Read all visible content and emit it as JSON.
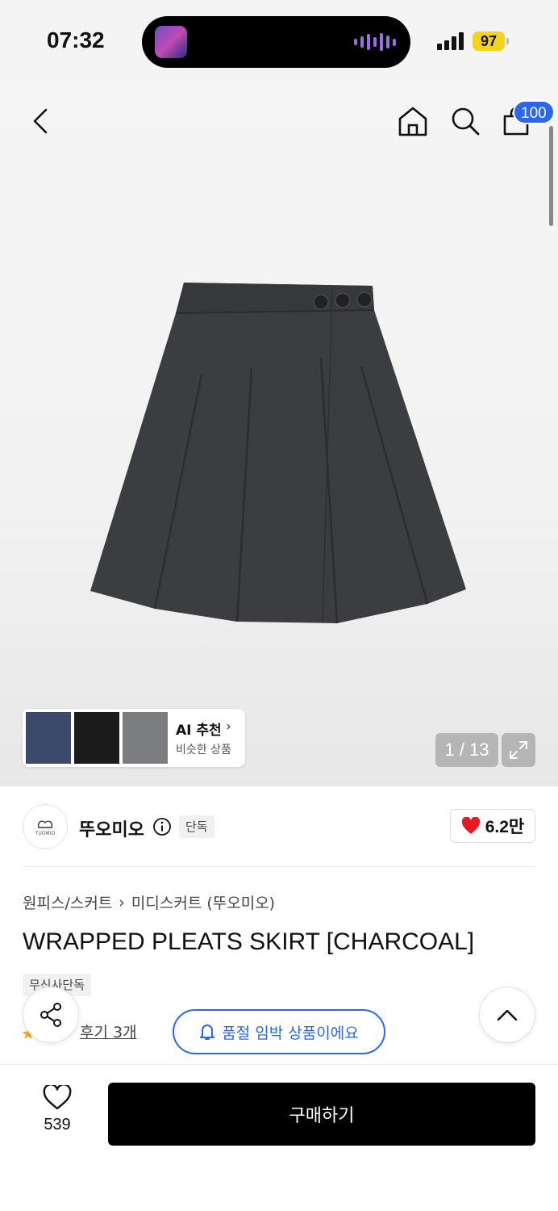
{
  "status_bar": {
    "time": "07:32",
    "battery": "97"
  },
  "header": {
    "cart_count": "100"
  },
  "gallery": {
    "counter": "1 / 13"
  },
  "ai_recommend": {
    "title": "AI 추천",
    "subtitle": "비슷한 상품"
  },
  "brand": {
    "name": "뚜오미오",
    "logo_text": "TUOMIO",
    "badge": "단독",
    "likes": "6.2만"
  },
  "breadcrumb": {
    "category": "원피스/스커트",
    "subcategory": "미디스커트 (뚜오미오)"
  },
  "product": {
    "title": "WRAPPED PLEATS SKIRT [CHARCOAL]",
    "tag": "무신사단독"
  },
  "reviews": {
    "label": "후기 3개"
  },
  "notice": {
    "soldout_label": "품절 임박 상품이에요"
  },
  "bottom_bar": {
    "wish_count": "539",
    "buy_label": "구매하기"
  },
  "colors": {
    "accent": "#2a66f0",
    "heart": "#e41b23",
    "buy": "#000000",
    "battery": "#f5d31a"
  }
}
